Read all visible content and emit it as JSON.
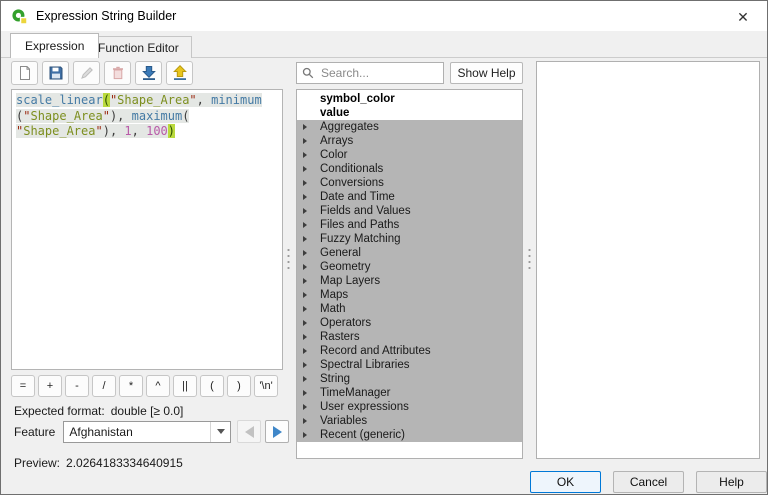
{
  "window": {
    "title": "Expression String Builder",
    "close_glyph": "✕"
  },
  "tabs": [
    {
      "label": "Expression",
      "active": true
    },
    {
      "label": "Function Editor",
      "active": false
    }
  ],
  "toolbar": {
    "buttons": [
      {
        "icon": "new-expression-icon",
        "enabled": true
      },
      {
        "icon": "save-expression-icon",
        "enabled": true
      },
      {
        "icon": "edit-expression-icon",
        "enabled": false
      },
      {
        "icon": "delete-expression-icon",
        "enabled": false
      },
      {
        "icon": "import-expressions-icon",
        "enabled": true
      },
      {
        "icon": "export-expressions-icon",
        "enabled": true
      }
    ]
  },
  "expression": {
    "lines": [
      [
        {
          "t": "scale_linear",
          "c": "fn"
        },
        {
          "t": "(",
          "c": "hl"
        },
        {
          "t": "\"",
          "c": "q"
        },
        {
          "t": "Shape_Area",
          "c": "field"
        },
        {
          "t": "\"",
          "c": "q"
        },
        {
          "t": ", ",
          "c": "pl"
        },
        {
          "t": "minimum",
          "c": "fn"
        }
      ],
      [
        {
          "t": "(",
          "c": "pl"
        },
        {
          "t": "\"",
          "c": "q"
        },
        {
          "t": "Shape_Area",
          "c": "field"
        },
        {
          "t": "\"",
          "c": "q"
        },
        {
          "t": "), ",
          "c": "pl"
        },
        {
          "t": "maximum",
          "c": "fn"
        },
        {
          "t": "(",
          "c": "pl"
        }
      ],
      [
        {
          "t": "\"",
          "c": "q"
        },
        {
          "t": "Shape_Area",
          "c": "field"
        },
        {
          "t": "\"",
          "c": "q"
        },
        {
          "t": "), ",
          "c": "pl"
        },
        {
          "t": "1",
          "c": "num"
        },
        {
          "t": ", ",
          "c": "pl"
        },
        {
          "t": "100",
          "c": "num"
        },
        {
          "t": ")",
          "c": "hl"
        }
      ]
    ]
  },
  "operators": [
    "=",
    "+",
    "-",
    "/",
    "*",
    "^",
    "||",
    "(",
    ")",
    "'\\n'"
  ],
  "expected_format": {
    "label": "Expected format:",
    "value": "double [≥ 0.0]"
  },
  "feature": {
    "label": "Feature",
    "value": "Afghanistan"
  },
  "preview": {
    "label": "Preview:",
    "value": "2.0264183334640915"
  },
  "search": {
    "placeholder": "Search..."
  },
  "show_help_label": "Show Help",
  "function_list": {
    "fields": [
      "symbol_color",
      "value"
    ],
    "groups": [
      "Aggregates",
      "Arrays",
      "Color",
      "Conditionals",
      "Conversions",
      "Date and Time",
      "Fields and Values",
      "Files and Paths",
      "Fuzzy Matching",
      "General",
      "Geometry",
      "Map Layers",
      "Maps",
      "Math",
      "Operators",
      "Rasters",
      "Record and Attributes",
      "Spectral Libraries",
      "String",
      "TimeManager",
      "User expressions",
      "Variables",
      "Recent (generic)"
    ]
  },
  "dialog_buttons": [
    {
      "label": "OK",
      "focused": true
    },
    {
      "label": "Cancel",
      "focused": false
    },
    {
      "label": "Help",
      "focused": false
    }
  ],
  "colors": {
    "titlebar_bg": "#ffffff",
    "dialog_bg": "#f0f0f0",
    "list_selection_gray": "#b5b5b5",
    "function_name": "#447aa4",
    "string_quote": "#9c2a12",
    "field_name": "#7d8f1f",
    "number": "#b85aa8",
    "paren_highlight_bg": "#bada3d",
    "unfocused_selection_bg": "#e4e7e4",
    "nav_arrow_blue": "#3e86c8",
    "ok_focus_border": "#0078d7"
  }
}
